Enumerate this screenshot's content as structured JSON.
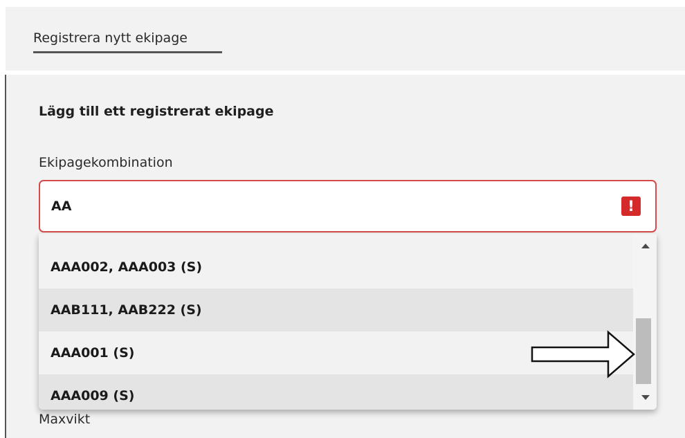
{
  "header": {
    "tab_label": "Registrera nytt ekipage"
  },
  "form": {
    "section_title": "Lägg till ett registrerat ekipage",
    "combination_label": "Ekipagekombination",
    "combination_value": "AA",
    "error_icon_text": "!",
    "next_field_label": "Maxvikt"
  },
  "dropdown": {
    "options": [
      {
        "label": "AAA002, AAA003 (S)"
      },
      {
        "label": "AAB111, AAB222 (S)"
      },
      {
        "label": "AAA001 (S)"
      },
      {
        "label": "AAA009 (S)"
      }
    ],
    "scroll_position": 0.75
  },
  "colors": {
    "error_red": "#d42a2a",
    "input_border_error": "#d54a4a",
    "panel_bg": "#f2f2f2",
    "option_alt_bg": "#e4e4e4"
  },
  "icons": {
    "error": "exclamation-icon",
    "scroll_up": "caret-up-icon",
    "scroll_down": "caret-down-icon",
    "annotation": "outline-arrow-right-icon"
  }
}
